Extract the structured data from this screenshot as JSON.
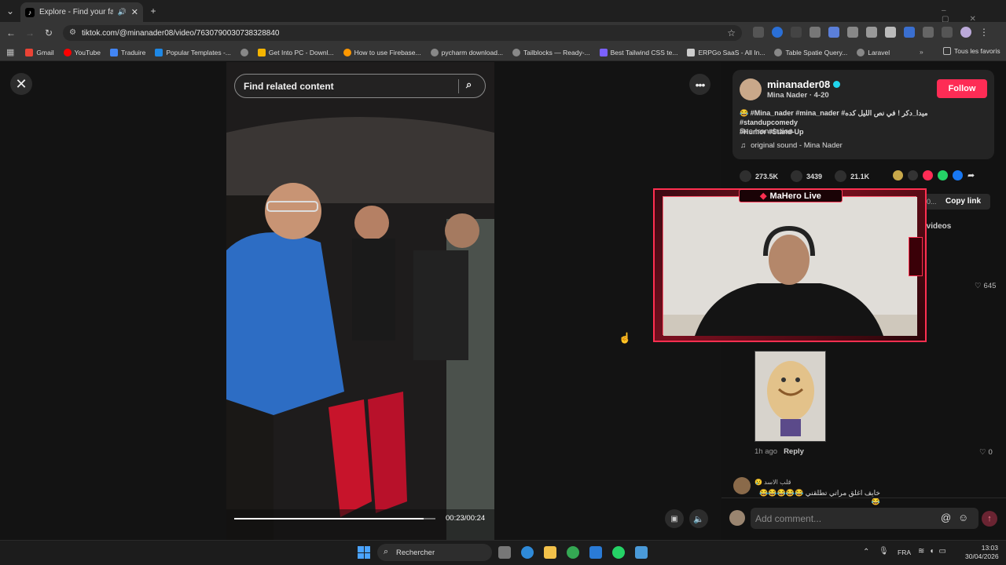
{
  "browser": {
    "tab_title": "Explore - Find your favourit",
    "url": "tiktok.com/@minanader08/video/7630790030738328840",
    "bookmarks": [
      "Gmail",
      "YouTube",
      "Traduire",
      "Popular Templates -...",
      "Get Into PC - Downl...",
      "How to use Firebase...",
      "pycharm download...",
      "Tailblocks — Ready-...",
      "Best Tailwind CSS te...",
      "ERPGo SaaS - All In...",
      "Table Spatie Query...",
      "Laravel"
    ],
    "all_bookmarks": "Tous les favoris",
    "accent_colors": {
      "tiktok_red": "#fe2c55",
      "overlay_red": "#ff2f50"
    }
  },
  "player": {
    "search_placeholder": "Find related content",
    "time": "00:23/00:24",
    "progress": 0.94
  },
  "author": {
    "username": "minanader08",
    "display": "Mina Nader · 4-20",
    "follow_label": "Follow",
    "caption_line1": "😂 #Mina_nader #mina_nader #ميدا_دكر ! في نص الليل كده",
    "caption_line2": "#Humor #Stand-Up",
    "caption_tag_end": "#standupcomedy",
    "see_translation": "See translation",
    "sound": "original sound - Mina Nader"
  },
  "stats": {
    "likes": "273.5K",
    "comments": "3439",
    "saves": "21.1K"
  },
  "copy_link": "Copy link",
  "partial_url": "0...",
  "videos_tab": "r videos",
  "overlay": {
    "brand": "MaHero Live"
  },
  "comments": [
    {
      "likes": "645"
    },
    {
      "time": "1h ago",
      "reply": "Reply",
      "likes": "0"
    },
    {
      "user": "قلب الاسد 😢",
      "text": "خايف اغلق مراتي تطلقني 😂😂😂😂😂😂"
    }
  ],
  "add_comment_placeholder": "Add comment...",
  "taskbar": {
    "search": "Rechercher",
    "lang": "FRA",
    "time": "13:03",
    "date": "30/04/2026"
  }
}
